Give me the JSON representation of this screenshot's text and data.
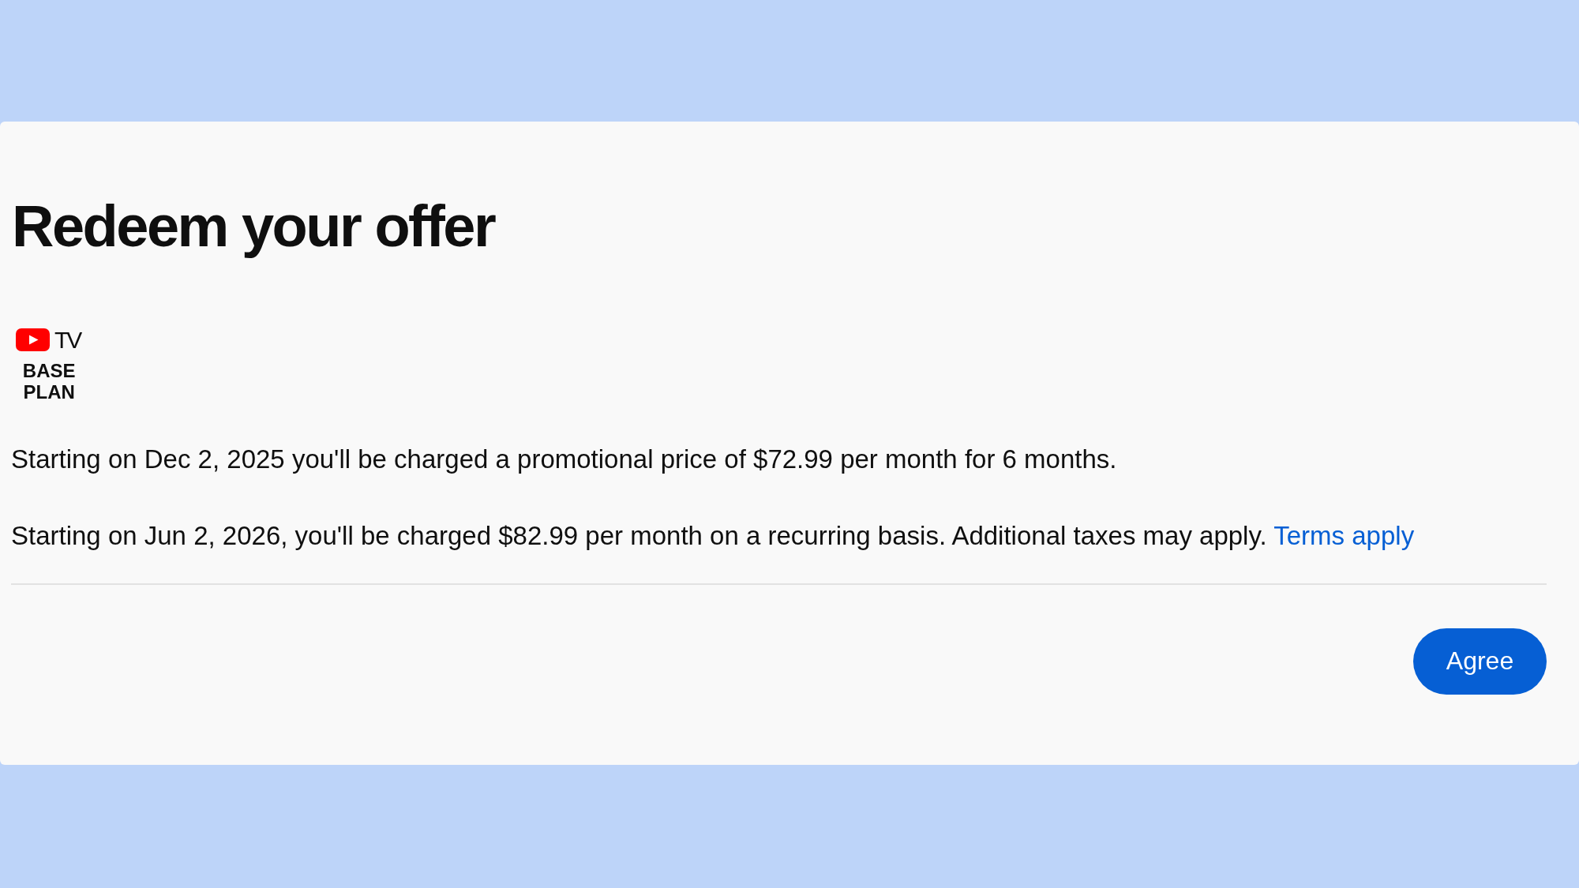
{
  "title": "Redeem your offer",
  "plan_badge": {
    "logo_text": "TV",
    "plan_name": "BASE PLAN"
  },
  "terms": [
    {
      "text": "Starting on Dec 2, 2025 you'll be charged a promotional price of $72.99 per month for 6 months."
    },
    {
      "text": "Starting on Jun 2, 2026, you'll be charged $82.99 per month on a recurring basis. Additional taxes may apply.",
      "link": "Terms apply"
    }
  ],
  "actions": [
    {
      "label": "Agree"
    }
  ]
}
